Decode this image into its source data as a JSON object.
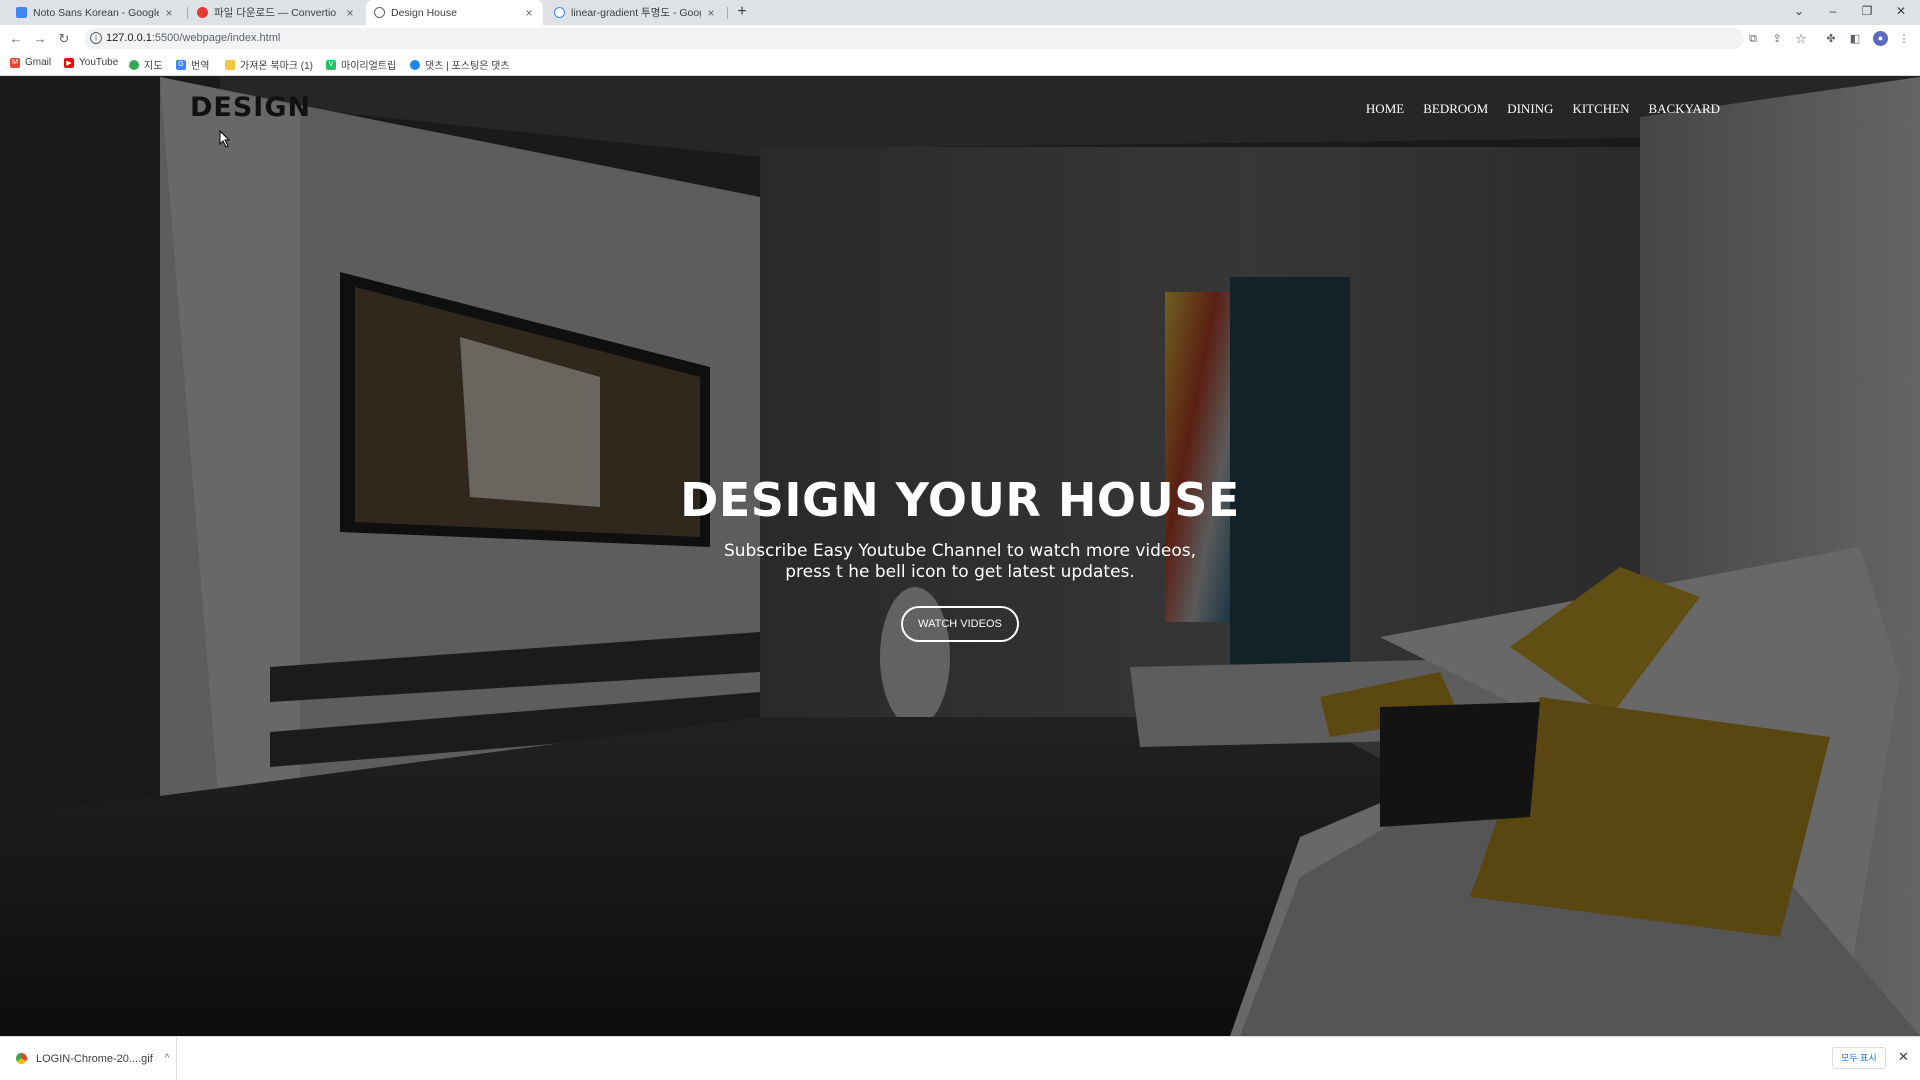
{
  "browser": {
    "tabs": [
      {
        "title": "Noto Sans Korean - Google Fo...",
        "active": false
      },
      {
        "title": "파일 다운로드 — Convertio",
        "active": false
      },
      {
        "title": "Design House",
        "active": true
      },
      {
        "title": "linear-gradient 투명도 - Googl...",
        "active": false
      }
    ],
    "url_host": "127.0.0.1",
    "url_rest": ":5500/webpage/index.html",
    "bookmarks": [
      "Gmail",
      "YouTube",
      "지도",
      "번역",
      "가져온 북마크 (1)",
      "마이리얼트립",
      "댓츠 | 포스팅은 댓츠"
    ]
  },
  "page": {
    "logo": "DESIGN",
    "nav": [
      "HOME",
      "BEDROOM",
      "DINING",
      "KITCHEN",
      "BACKYARD"
    ],
    "hero": {
      "title": "DESIGN YOUR HOUSE",
      "line1": "Subscribe Easy Youtube Channel to watch more videos,",
      "line2": "press t he bell icon to get latest updates.",
      "button": "WATCH VIDEOS"
    }
  },
  "downloads": {
    "file": "LOGIN-Chrome-20....gif",
    "show_all": "모두 표시"
  }
}
